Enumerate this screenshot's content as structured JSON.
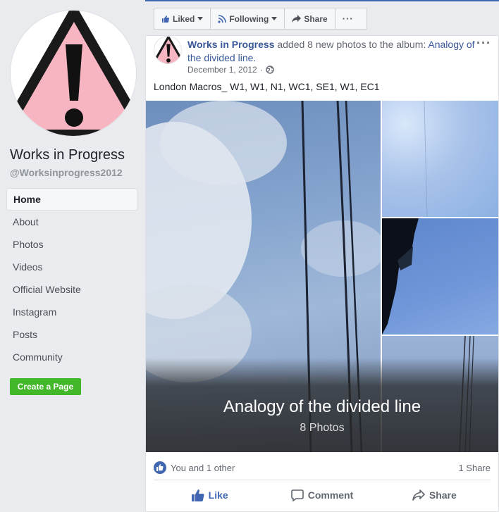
{
  "page": {
    "name": "Works in Progress",
    "handle": "@Worksinprogress2012"
  },
  "sidebar": {
    "items": [
      {
        "label": "Home",
        "active": true
      },
      {
        "label": "About"
      },
      {
        "label": "Photos"
      },
      {
        "label": "Videos"
      },
      {
        "label": "Official Website"
      },
      {
        "label": "Instagram"
      },
      {
        "label": "Posts"
      },
      {
        "label": "Community"
      }
    ],
    "create_page_label": "Create a Page"
  },
  "actionbar": {
    "liked_label": "Liked",
    "following_label": "Following",
    "share_label": "Share",
    "more_label": "···"
  },
  "post": {
    "author": "Works in Progress",
    "action_text": " added 8 new photos to the album: ",
    "album_link": "Analogy of the divided line.",
    "date": "December 1, 2012",
    "separator": "·",
    "text": "London Macros_ W1, W1, N1, WC1, SE1, W1, EC1",
    "album_title": "Analogy of the divided line",
    "photo_count": "8 Photos",
    "more_label": "···"
  },
  "footer": {
    "reactions_text": "You and 1 other",
    "shares_text": "1 Share",
    "like_label": "Like",
    "comment_label": "Comment",
    "share_label": "Share"
  },
  "colors": {
    "brand": "#4267b2",
    "link": "#385898",
    "create_button": "#42b72a",
    "warning_pink": "#f7b5c2"
  },
  "icons": [
    "warning-sign-logo",
    "thumbs-up-icon",
    "rss-follow-icon",
    "share-arrow-icon",
    "globe-icon",
    "like-reaction-icon",
    "comment-icon",
    "chevron-down-icon"
  ]
}
